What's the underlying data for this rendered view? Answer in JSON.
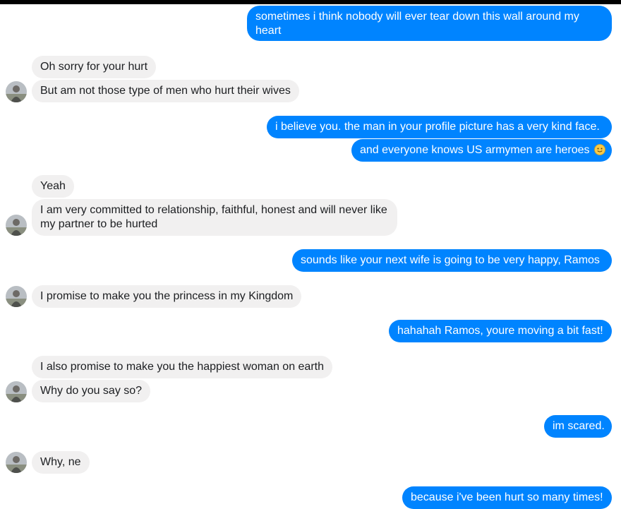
{
  "conversation": {
    "messages": [
      {
        "sender": "me",
        "text": "sometimes i think nobody will ever tear down this wall around my heart"
      },
      {
        "sender": "other",
        "text": "Oh sorry for your hurt"
      },
      {
        "sender": "other",
        "text": "But am not those type of men who hurt their wives"
      },
      {
        "sender": "me",
        "text": "i believe you. the man in your profile picture has a very kind face."
      },
      {
        "sender": "me",
        "text": "and everyone knows US armymen are heroes",
        "emoji": "slightly-smiling-face"
      },
      {
        "sender": "other",
        "text": "Yeah"
      },
      {
        "sender": "other",
        "text": "I am very committed to relationship, faithful, honest and will never like my partner to be hurted"
      },
      {
        "sender": "me",
        "text": "sounds like your next wife is going to be very happy, Ramos"
      },
      {
        "sender": "other",
        "text": "I promise to make you the princess in my Kingdom"
      },
      {
        "sender": "me",
        "text": "hahahah Ramos, youre moving a bit fast!"
      },
      {
        "sender": "other",
        "text": "I also promise to make you  the happiest woman on earth"
      },
      {
        "sender": "other",
        "text": "Why do you say so?"
      },
      {
        "sender": "me",
        "text": "im scared."
      },
      {
        "sender": "other",
        "text": "Why, ne"
      },
      {
        "sender": "me",
        "text": "because i've been hurt so many times!"
      }
    ]
  },
  "colors": {
    "outgoing_bubble": "#0084ff",
    "incoming_bubble": "#f1f0f0",
    "outgoing_text": "#ffffff",
    "incoming_text": "#1c1e21"
  }
}
